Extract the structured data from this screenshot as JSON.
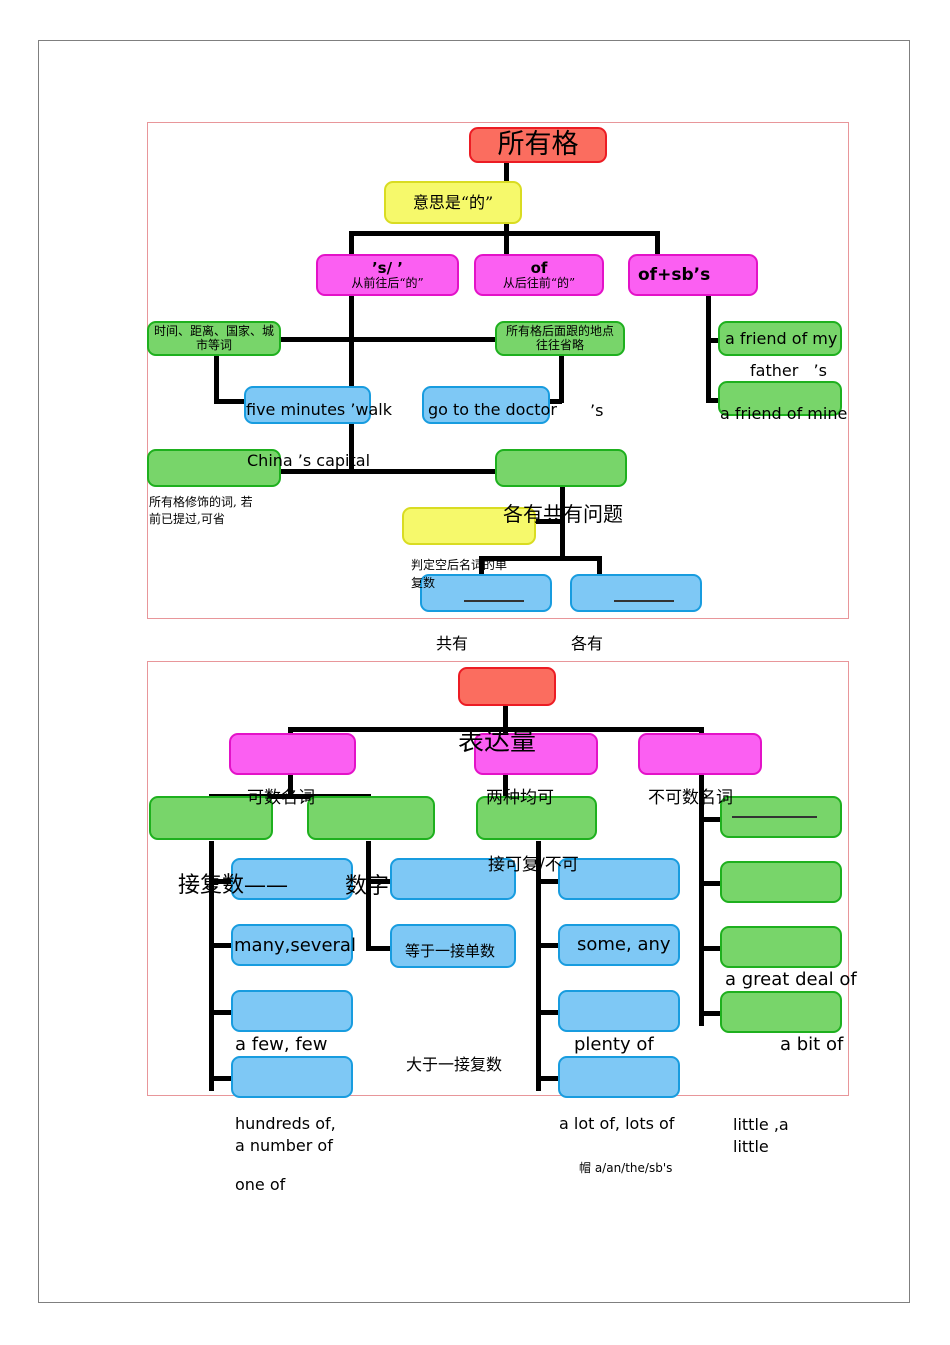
{
  "document": {
    "title_visible": false
  },
  "diagram1": {
    "root": {
      "label": "所有格",
      "color": "#fb6d5f"
    },
    "note_yellow": {
      "label": "意思是“的”",
      "color": "#f6f96b"
    },
    "branches": [
      {
        "label": "’s/ ’",
        "sub": "从前往后“的”",
        "color": "#fb5ff2"
      },
      {
        "label": "of",
        "sub": "从后往前“的”",
        "color": "#fb5ff2"
      },
      {
        "label": "of+sb’s",
        "sub": "",
        "color": "#fb5ff2"
      }
    ],
    "green_left": {
      "label": "时间、距离、国家、城市等词"
    },
    "green_mid": {
      "label": "所有格后面跟的地点往往省略"
    },
    "green_left2": {
      "label": ""
    },
    "green_mid2": {
      "label": ""
    },
    "green_right1": {
      "label": "a friend of my"
    },
    "green_right2": {
      "label": "a friend of mine"
    },
    "blue_left": {
      "label": "five minutes ’walk"
    },
    "blue_mid": {
      "label": "go to the doctor"
    },
    "floating": {
      "china": "China ’s capital",
      "apostrophe_s": "’s",
      "fathers": "father   ’s",
      "note_small": "所有格修饰的词, 若\n前已提过,可省",
      "gongyou_title": "各有共有问题",
      "judge": "判定空后名词的单\n复数",
      "gongyou": "共有",
      "geyou": "各有"
    },
    "yellow_bottom": {
      "label": ""
    },
    "blue_bottom_left": {
      "label": ""
    },
    "blue_bottom_right": {
      "label": ""
    }
  },
  "diagram2": {
    "root": {
      "label": "",
      "color": "#fb6d5f"
    },
    "root_text": "表达量",
    "branches": [
      {
        "label": "",
        "text_below": "可数名词"
      },
      {
        "label": "",
        "text_below": "两种均可"
      },
      {
        "label": "",
        "text_below": "不可数名词"
      }
    ],
    "green_row": [
      {
        "label": "",
        "text_below": "接复数——"
      },
      {
        "label": "",
        "text_below": "数字"
      },
      {
        "label": "",
        "text_below": "接可复/不可"
      },
      {
        "label": "",
        "text_below": ""
      }
    ],
    "col1_blue": [
      {
        "label": ""
      },
      {
        "label": "many,several"
      },
      {
        "label": ""
      },
      {
        "label": ""
      }
    ],
    "col1_texts": {
      "afewfew": "a few, few",
      "hundreds": "hundreds of,\na number of",
      "oneof": "one of"
    },
    "col2_blue": [
      {
        "label": ""
      },
      {
        "label": "等于一接单数"
      }
    ],
    "col2_texts": {
      "dayuyi": "大于一接复数"
    },
    "col3_blue": [
      {
        "label": ""
      },
      {
        "label": "some, any"
      },
      {
        "label": ""
      },
      {
        "label": ""
      }
    ],
    "col3_texts": {
      "plentyof": "plenty of",
      "alotof": "a lot of, lots of",
      "mao": "帽 a/an/the/sb's"
    },
    "col4_green": [
      {
        "label": ""
      },
      {
        "label": ""
      },
      {
        "label": ""
      },
      {
        "label": ""
      }
    ],
    "col4_texts": {
      "greatdeal": "a great deal of",
      "abitof": "a bit of",
      "little": "little ,a\nlittle"
    }
  },
  "colors": {
    "red": "#fb6d5f",
    "red_border": "#ec1c24",
    "yellow": "#f6f96b",
    "yellow_border": "#d9dc22",
    "pink": "#fb5ff2",
    "pink_border": "#e312c8",
    "green": "#78d56a",
    "green_border": "#1eb01e",
    "blue": "#7ec8f5",
    "blue_border": "#189cdf",
    "frame": "#e8969a",
    "page_border": "#7f7f7f"
  }
}
